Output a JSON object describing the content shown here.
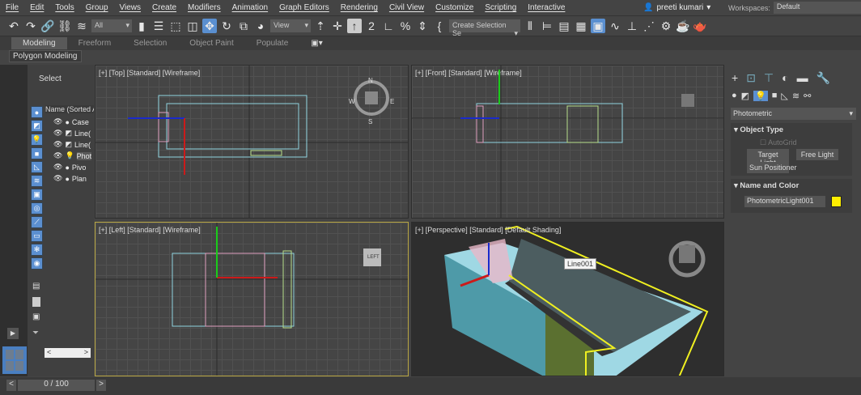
{
  "menu": [
    "File",
    "Edit",
    "Tools",
    "Group",
    "Views",
    "Create",
    "Modifiers",
    "Animation",
    "Graph Editors",
    "Rendering",
    "Civil View",
    "Customize",
    "Scripting",
    "Interactive"
  ],
  "user": {
    "name": "preeti kumari"
  },
  "workspace": {
    "label": "Workspaces:",
    "value": "Default"
  },
  "toolbar": {
    "filter": "All",
    "refcoord": "View",
    "selection_set": "Create Selection Se"
  },
  "ribbon": {
    "tabs": [
      "Modeling",
      "Freeform",
      "Selection",
      "Object Paint",
      "Populate"
    ],
    "subtab": "Polygon Modeling"
  },
  "explorer": {
    "title": "Select",
    "column": "Name (Sorted A",
    "items": [
      "Case",
      "Line(",
      "Line(",
      "Phot",
      "Pivo",
      "Plan"
    ]
  },
  "viewports": {
    "top": "[+] [Top] [Standard] [Wireframe]",
    "front": "[+] [Front] [Standard] [Wireframe]",
    "left": "[+] [Left] [Standard] [Wireframe]",
    "perspective": "[+] [Perspective] [Standard] [Default Shading]",
    "tooltip": "Line001",
    "compass": {
      "n": "N",
      "s": "S",
      "e": "E",
      "w": "W"
    },
    "cube_left": "LEFT"
  },
  "command_panel": {
    "category": "Photometric",
    "object_type": "Object Type",
    "autogrid": "AutoGrid",
    "buttons": [
      "Target Light",
      "Free Light",
      "Sun Positioner"
    ],
    "name_color": "Name and Color",
    "name_value": "PhotometricLight001",
    "color": "#ffee00"
  },
  "timeline": {
    "frame": "0 / 100"
  }
}
